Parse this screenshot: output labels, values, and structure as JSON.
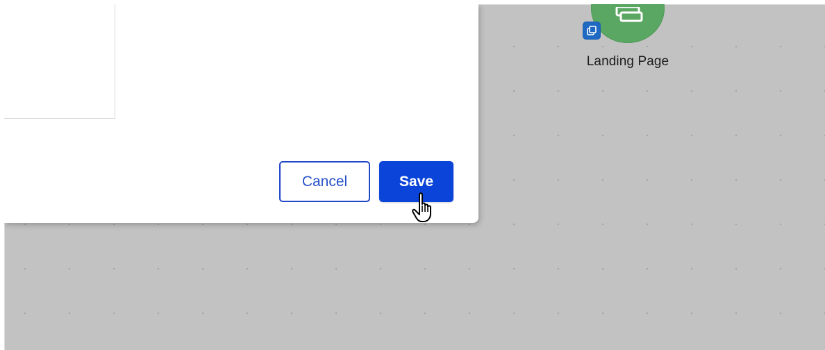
{
  "landing_node": {
    "label": "Landing Page",
    "circle_icon": "screens-icon",
    "badge_icon": "copy-page-icon",
    "circle_color": "#5aa663",
    "badge_color": "#1f69c3"
  },
  "modal": {
    "cancel_label": "Cancel",
    "save_label": "Save"
  },
  "colors": {
    "canvas_background": "#c2c2c2",
    "primary_button": "#0a44d9",
    "secondary_button_border": "#2147c7"
  },
  "cursor": {
    "icon": "hand-pointer-icon"
  }
}
